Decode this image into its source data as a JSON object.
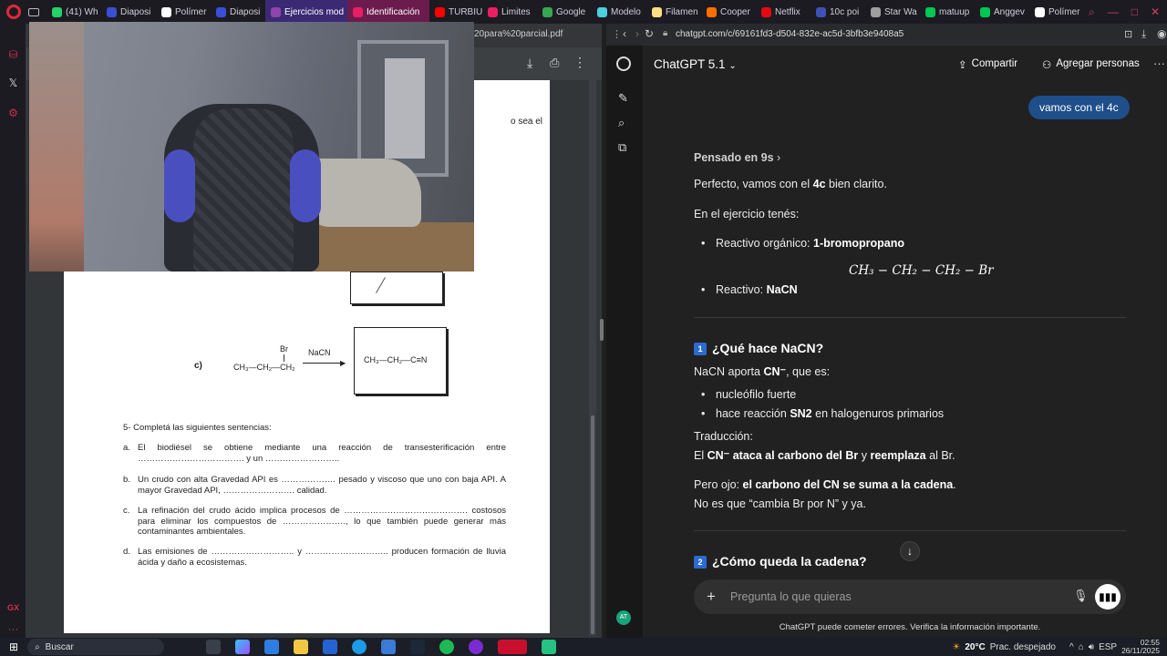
{
  "tabs": [
    {
      "label": "(41) Wh",
      "color": "#25d366"
    },
    {
      "label": "Diaposi",
      "color": "#3b4fd4"
    },
    {
      "label": "Polímer",
      "color": "#ffffff"
    },
    {
      "label": "Diaposi",
      "color": "#3b4fd4"
    },
    {
      "label": "Ejercicios mod",
      "color": "#8e44ad"
    },
    {
      "label": "Identificación",
      "color": "#e91e63"
    },
    {
      "label": "TURBIU",
      "color": "#ff0000"
    },
    {
      "label": "Limites",
      "color": "#e91e63"
    },
    {
      "label": "Google",
      "color": "#34a853"
    },
    {
      "label": "Modelo",
      "color": "#4dd0e1"
    },
    {
      "label": "Filamen",
      "color": "#ffe082"
    },
    {
      "label": "Cooper",
      "color": "#ff6f00"
    },
    {
      "label": "Netflix",
      "color": "#e50914"
    },
    {
      "label": "10c poi",
      "color": "#3f51b5"
    },
    {
      "label": "Star Wa",
      "color": "#9e9e9e"
    },
    {
      "label": "matuup",
      "color": "#00c853"
    },
    {
      "label": "Anggev",
      "color": "#00c853"
    },
    {
      "label": "Polímer",
      "color": "#ffffff"
    }
  ],
  "pdf": {
    "url_fragment": "20para%20parcial.pdf",
    "cut_text": "o sea el",
    "reaction": {
      "label": "c)",
      "reactant": "CH₃—CH₂—CH₂",
      "substituent": "Br",
      "reagent": "NaCN",
      "product": "CH₃—CH₂—C≡N"
    },
    "question_title": "5-   Completá las siguientes sentencias:",
    "items": [
      {
        "letter": "a.",
        "text": "El biodiésel se obtiene mediante una reacción de transesterificación entre ………………………………. y un …………………….."
      },
      {
        "letter": "b.",
        "text": "Un crudo con alta Gravedad API es ………………. pesado y viscoso que uno con baja API. A mayor Gravedad API, ……………………. calidad."
      },
      {
        "letter": "c.",
        "text": "La refinación del crudo ácido implica procesos de ……………………………………. costosos para eliminar los compuestos de …………………., lo que también puede generar más contaminantes ambientales."
      },
      {
        "letter": "d.",
        "text": "Las emisiones de ……………………….. y ……………………….. producen formación de lluvia ácida y daño a ecosistemas."
      }
    ]
  },
  "chat": {
    "url": "chatgpt.com/c/69161fd3-d504-832e-ac5d-3bfb3e9408a5",
    "model": "ChatGPT 5.1",
    "share": "Compartir",
    "add_people": "Agregar personas",
    "user_msg": "vamos con el 4c",
    "thought": "Pensado en 9s",
    "p1_pre": "Perfecto, vamos con el ",
    "p1_bold": "4c",
    "p1_post": " bien clarito.",
    "p2": "En el ejercicio tenés:",
    "li1_pre": "Reactivo orgánico: ",
    "li1_bold": "1-bromopropano",
    "formula": "CH₃ − CH₂ − CH₂ − Br",
    "li2_pre": "Reactivo: ",
    "li2_bold": "NaCN",
    "h1_num": "1",
    "h1": "¿Qué hace NaCN?",
    "p3_pre": "NaCN aporta ",
    "p3_bold": "CN⁻",
    "p3_post": ", que es:",
    "li3": "nucleófilo fuerte",
    "li4_pre": "hace reacción ",
    "li4_bold": "SN2",
    "li4_post": " en halogenuros primarios",
    "p4": "Traducción:",
    "p5_a": "El ",
    "p5_b": "CN⁻ ataca al carbono del Br",
    "p5_c": " y ",
    "p5_d": "reemplaza",
    "p5_e": " al Br.",
    "p6_pre": "Pero ojo: ",
    "p6_bold": "el carbono del CN se suma a la cadena",
    "p6_post": ".",
    "p7": "No es que “cambia Br por N” y ya.",
    "h2_num": "2",
    "h2": "¿Cómo queda la cadena?",
    "input_placeholder": "Pregunta lo que quieras",
    "disclaimer": "ChatGPT puede cometer errores. Verifica la información importante.",
    "avatar": "AT"
  },
  "taskbar": {
    "search": "Buscar",
    "weather_temp": "20°C",
    "weather_text": "Prac. despejado",
    "lang": "ESP",
    "time": "02:55",
    "date": "26/11/2025"
  }
}
